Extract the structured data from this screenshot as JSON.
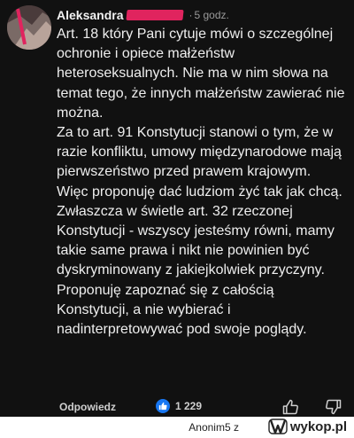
{
  "comment": {
    "author": "Aleksandra",
    "separator": "·",
    "time": "5 godz.",
    "paragraphs": [
      "Art. 18 który Pani cytuje mówi o szczególnej ochronie i opiece małżeństw heteroseksualnych. Nie ma w nim słowa na temat tego, że innych małżeństw zawierać nie można.",
      "Za to art. 91 Konstytucji stanowi o tym, że w razie konfliktu, umowy międzynarodowe mają pierwszeństwo przed prawem krajowym.",
      "Więc proponuję dać ludziom żyć tak jak chcą. Zwłaszcza w świetle art. 32 rzeczonej Konstytucji - wszyscy jesteśmy równi, mamy takie same prawa i nikt nie powinien być dyskryminowany z jakiejkolwiek przyczyny.",
      "Proponuję zapoznać się z całością Konstytucji, a nie wybierać i nadinterpretowywać pod swoje poglądy."
    ]
  },
  "actions": {
    "reply_label": "Odpowiedz",
    "like_count": "1 229",
    "like_icon": "thumbs-up-icon",
    "thumb_up_icon": "thumbs-up-outline-icon",
    "thumb_down_icon": "thumbs-down-outline-icon"
  },
  "watermark": {
    "user": "Anonim5",
    "connector": "z",
    "site": "wykop.pl"
  },
  "colors": {
    "background": "#111111",
    "text": "#eeeeee",
    "muted": "#9a9a9a",
    "redaction": "#e0245e",
    "like_badge": "#1877f2"
  }
}
